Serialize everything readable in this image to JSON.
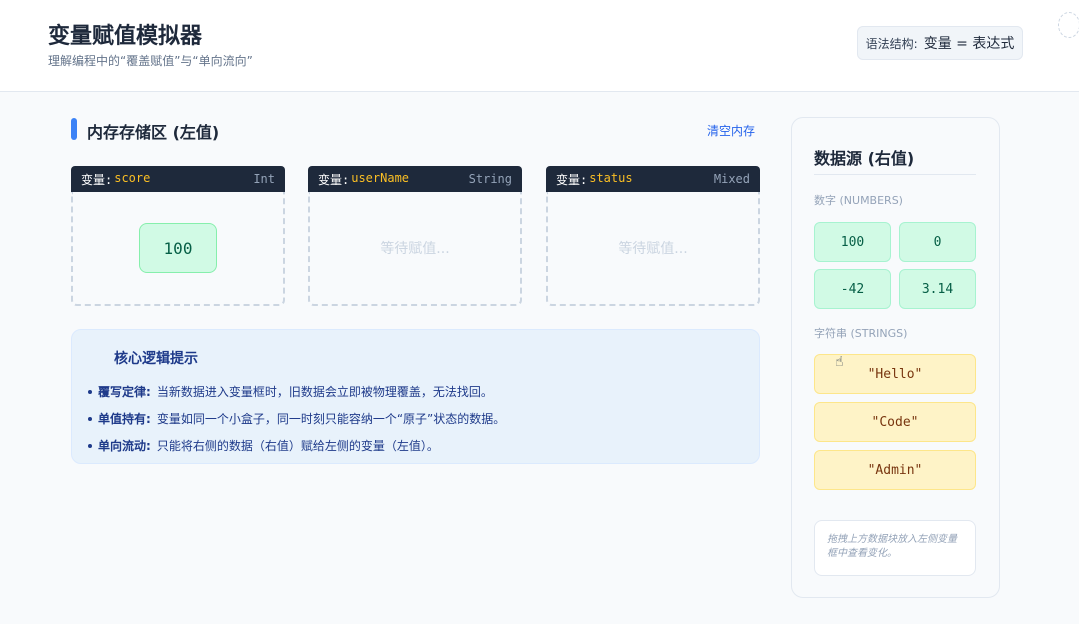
{
  "header": {
    "title": "变量赋值模拟器",
    "subtitle": "理解编程中的“覆盖赋值”与“单向流向”",
    "syntax_label": "语法结构:",
    "syntax_expr": "变量 = 表达式"
  },
  "memory": {
    "title": "内存存储区 (左值)",
    "clear_label": "清空内存",
    "variables": [
      {
        "prefix": "变量:",
        "name": "score",
        "type": "Int",
        "value": "100",
        "placeholder": ""
      },
      {
        "prefix": "变量:",
        "name": "userName",
        "type": "String",
        "value": "",
        "placeholder": "等待赋值..."
      },
      {
        "prefix": "变量:",
        "name": "status",
        "type": "Mixed",
        "value": "",
        "placeholder": "等待赋值..."
      }
    ]
  },
  "tips": {
    "title": "核心逻辑提示",
    "items": [
      {
        "label": "覆写定律:",
        "text": "当新数据进入变量框时，旧数据会立即被物理覆盖，无法找回。"
      },
      {
        "label": "单值持有:",
        "text": "变量如同一个小盒子，同一时刻只能容纳一个“原子”状态的数据。"
      },
      {
        "label": "单向流动:",
        "text": "只能将右侧的数据（右值）赋给左侧的变量（左值）。"
      }
    ]
  },
  "source": {
    "title": "数据源 (右值)",
    "numbers_label": "数字 (NUMBERS)",
    "numbers": [
      "100",
      "0",
      "-42",
      "3.14"
    ],
    "strings_label": "字符串 (STRINGS)",
    "strings": [
      "\"Hello\"",
      "\"Code\"",
      "\"Admin\""
    ],
    "hint": "拖拽上方数据块放入左侧变量框中查看变化。"
  },
  "colors": {
    "accent": "#3b82f6",
    "number_chip": "#d1fae5",
    "string_chip": "#fef3c7",
    "var_header": "#1e293b",
    "var_name": "#fbbf24"
  },
  "icons": {
    "cursor": "hand-cursor-icon",
    "spinner": "loading-spinner-icon"
  }
}
